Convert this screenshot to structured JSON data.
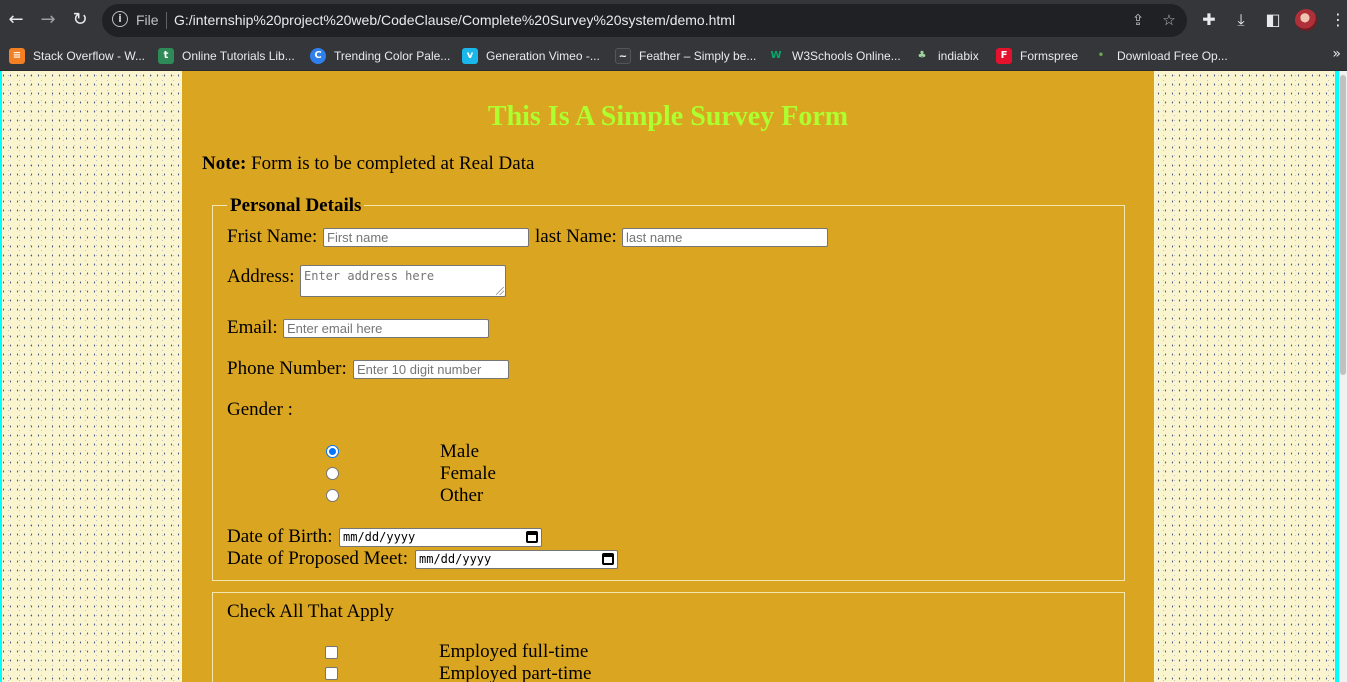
{
  "browser": {
    "file_label": "File",
    "url": "G:/internship%20project%20web/CodeClause/Complete%20Survey%20system/demo.html",
    "bookmarks": [
      {
        "label": "Stack Overflow - W...",
        "color": "#f48024",
        "icon": "stack-overflow-icon"
      },
      {
        "label": "Online Tutorials Lib...",
        "color": "#2e8b57",
        "icon": "tutorials-icon"
      },
      {
        "label": "Trending Color Pale...",
        "color": "#2f80ed",
        "icon": "color-palette-icon"
      },
      {
        "label": "Generation Vimeo -...",
        "color": "#1ab7ea",
        "icon": "vimeo-icon"
      },
      {
        "label": "Feather – Simply be...",
        "color": "#3a3b3e",
        "icon": "feather-icon"
      },
      {
        "label": "W3Schools Online...",
        "color": "#04aa6d",
        "icon": "w3schools-icon"
      },
      {
        "label": "indiabix",
        "color": "#9fd39f",
        "icon": "indiabix-icon"
      },
      {
        "label": "Formspree",
        "color": "#e5122e",
        "icon": "formspree-icon"
      },
      {
        "label": "Download Free Op...",
        "color": "#6aa84f",
        "icon": "download-icon"
      }
    ]
  },
  "page": {
    "title": "This Is A Simple Survey Form",
    "note_bold": "Note:",
    "note_text": " Form is to be completed at Real Data"
  },
  "personal": {
    "legend": "Personal Details",
    "first_name_label": "Frist Name:",
    "first_name_placeholder": "First name",
    "last_name_label": "last Name:",
    "last_name_placeholder": "last name",
    "address_label": "Address:",
    "address_placeholder": "Enter address here",
    "email_label": "Email:",
    "email_placeholder": "Enter email here",
    "phone_label": "Phone Number:",
    "phone_placeholder": "Enter 10 digit number",
    "gender_label": "Gender :",
    "genders": [
      {
        "label": "Male",
        "checked": true
      },
      {
        "label": "Female",
        "checked": false
      },
      {
        "label": "Other",
        "checked": false
      }
    ],
    "dob_label": "Date of Birth:",
    "dob_value": "mm/dd/yyyy",
    "meet_label": "Date of Proposed Meet:",
    "meet_value": "mm/dd/yyyy"
  },
  "check": {
    "heading": "Check All That Apply",
    "options": [
      {
        "label": "Employed full-time",
        "checked": false
      },
      {
        "label": "Employed part-time",
        "checked": false
      }
    ]
  }
}
